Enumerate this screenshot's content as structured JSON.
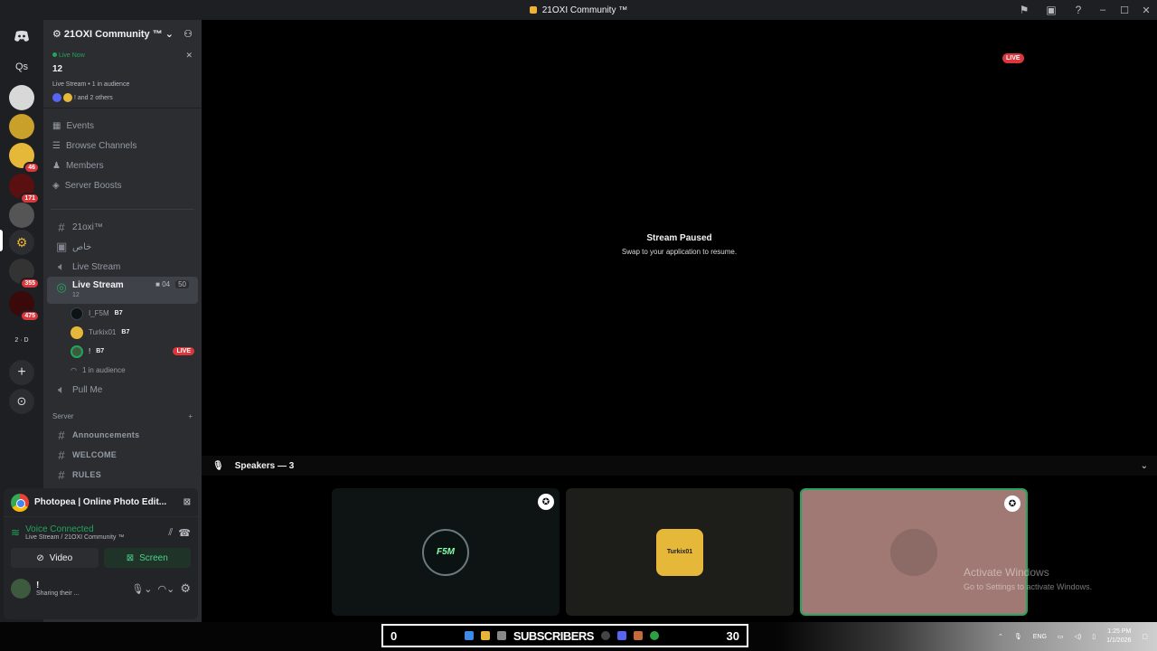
{
  "window": {
    "title": "21OXI Community ™"
  },
  "servers": {
    "items": [
      {
        "label": "",
        "badge": ""
      },
      {
        "label": "Qs",
        "badge": ""
      },
      {
        "label": "",
        "badge": ""
      },
      {
        "label": "",
        "badge": ""
      },
      {
        "label": "",
        "badge": "46"
      },
      {
        "label": "",
        "badge": "171"
      },
      {
        "label": "",
        "badge": ""
      },
      {
        "label": "",
        "badge": ""
      },
      {
        "label": "",
        "badge": "355"
      },
      {
        "label": "",
        "badge": "475"
      },
      {
        "label": "2 · D",
        "badge": ""
      }
    ]
  },
  "guild": {
    "name": "21OXI Community ™"
  },
  "live_card": {
    "status": "Live Now",
    "title": "12",
    "sub": "Live Stream • 1 in audience",
    "others": "! and 2 others"
  },
  "menu": {
    "events": "Events",
    "browse": "Browse Channels",
    "members": "Members",
    "boosts": "Server Boosts"
  },
  "channels": {
    "c1": "21oxi™",
    "c2": "خاص",
    "c3": "Live Stream",
    "active": {
      "name": "Live Stream",
      "sub": "12",
      "cam": "04",
      "count": "50"
    },
    "users": [
      {
        "name": "I_F5M",
        "tag": "B7",
        "live": ""
      },
      {
        "name": "Turkix01",
        "tag": "B7",
        "live": ""
      },
      {
        "name": "!",
        "tag": "B7",
        "live": "LIVE"
      }
    ],
    "audience": "1 in audience",
    "c4": "Pull Me",
    "category": "Server",
    "c5": "Announcements",
    "c6": "WELCOME",
    "c7": "RULES"
  },
  "panel": {
    "activity": "Photopea | Online Photo Edit...",
    "vc_title": "Voice Connected",
    "vc_sub": "Live Stream / 21OXI Community ™",
    "video": "Video",
    "screen": "Screen",
    "user_name": "!",
    "user_status": "Sharing their ..."
  },
  "stream": {
    "live": "LIVE",
    "paused_title": "Stream Paused",
    "paused_sub": "Swap to your application to resume.",
    "speakers": "Speakers — 3"
  },
  "tiles": [
    {
      "label": "F5M",
      "bg": "#0e1414"
    },
    {
      "label": "Turkix01",
      "bg": "#1d1d1a"
    },
    {
      "label": "",
      "bg": "#a07874"
    }
  ],
  "watermark": {
    "line1": "Activate Windows",
    "line2": "Go to Settings to activate Windows."
  },
  "taskbar": {
    "left_num": "0",
    "subs": "SUBSCRIBERS",
    "right_num": "30",
    "lang": "ENG",
    "time": "1:25 PM",
    "date": "1/1/2026"
  },
  "colors": {
    "accent": "#5865f2",
    "green": "#23a55a",
    "red": "#da373c"
  }
}
